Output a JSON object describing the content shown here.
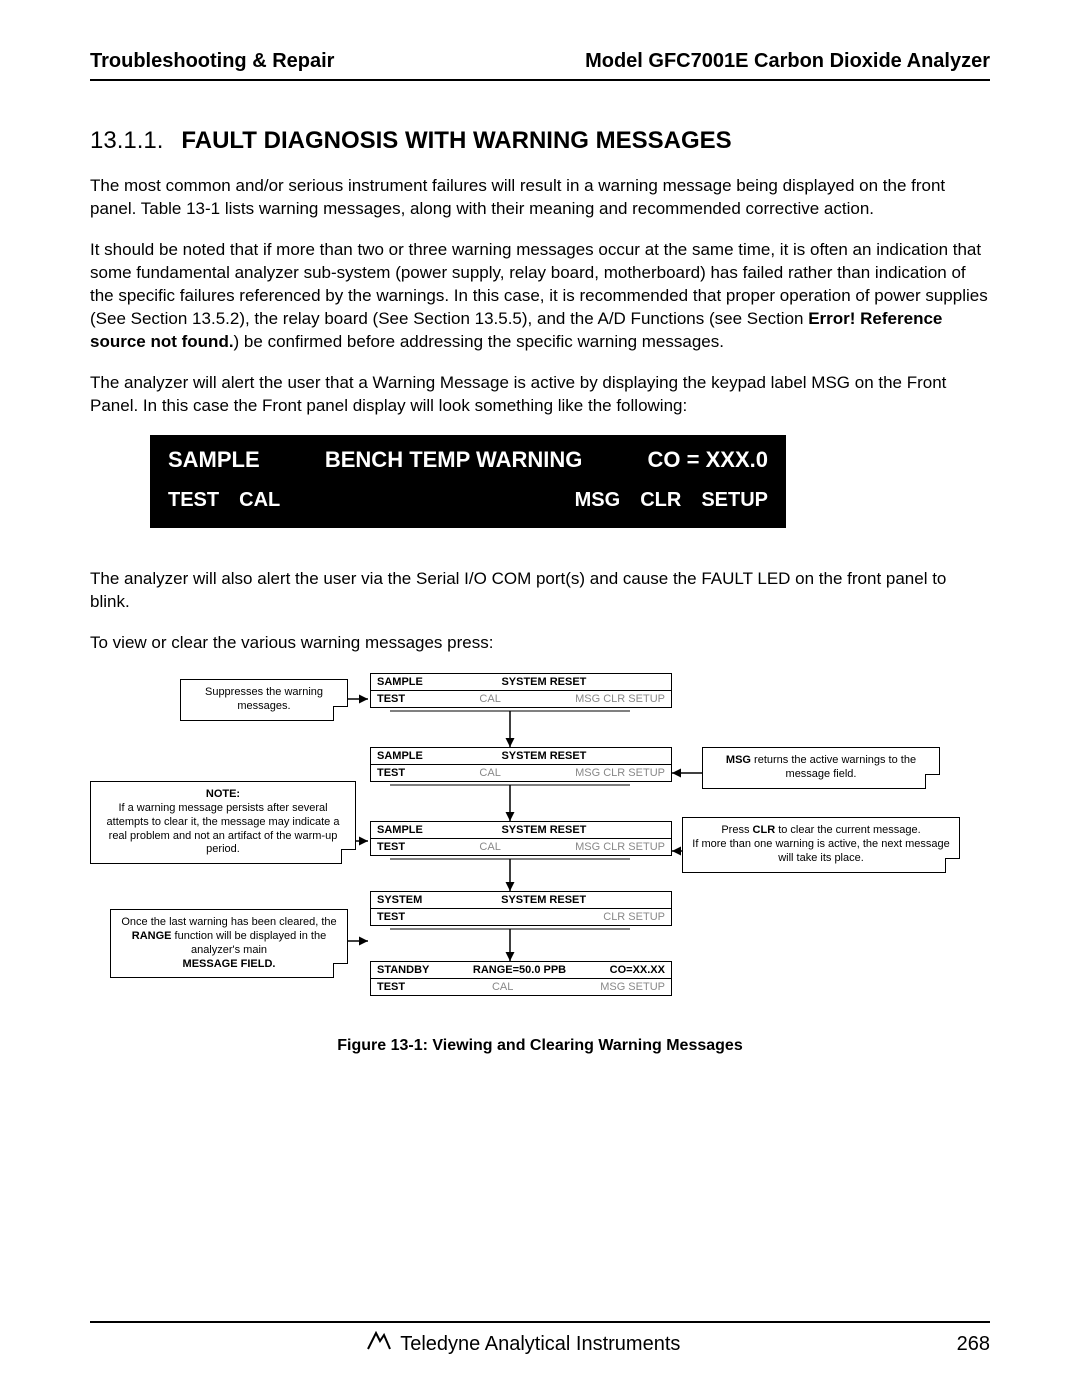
{
  "header": {
    "left": "Troubleshooting & Repair",
    "right": "Model GFC7001E Carbon Dioxide Analyzer"
  },
  "section": {
    "num": "13.1.1.",
    "title": "FAULT DIAGNOSIS WITH WARNING MESSAGES"
  },
  "para1": "The most common and/or serious instrument failures will result in a warning message being displayed on the front panel.  Table 13-1 lists warning messages, along with their meaning and recommended corrective action.",
  "para2a": "It should be noted that if more than two or three warning messages occur at the same time, it is often an indication that some fundamental analyzer sub-system (power supply, relay board, motherboard) has failed rather than indication of the specific failures referenced by the warnings.  In this case, it is recommended that proper operation of power supplies (See Section 13.5.2), the relay board (See Section 13.5.5), and the A/D Functions (see Section ",
  "para2b": "Error! Reference source not found.",
  "para2c": ") be confirmed before addressing the specific warning messages.",
  "para3": "The analyzer will alert the user that a Warning Message is active by displaying the keypad label MSG on the Front Panel.  In this case the Front panel display will look something like the following:",
  "lcd": {
    "r1a": "SAMPLE",
    "r1b": "BENCH TEMP WARNING",
    "r1c": "CO = XXX.0",
    "r2": [
      "TEST",
      "CAL",
      "MSG",
      "CLR",
      "SETUP"
    ]
  },
  "para4": "The analyzer will also alert the user via the Serial I/O COM port(s) and cause the FAULT LED on the front panel to blink.",
  "para5": "To view or clear the various warning messages press:",
  "panels": [
    {
      "tl": "SAMPLE",
      "tc": "SYSTEM RESET",
      "tr": "",
      "bl": "TEST",
      "bm": "CAL",
      "br": "MSG  CLR  SETUP"
    },
    {
      "tl": "SAMPLE",
      "tc": "SYSTEM RESET",
      "tr": "",
      "bl": "TEST",
      "bm": "CAL",
      "br": "MSG  CLR  SETUP"
    },
    {
      "tl": "SAMPLE",
      "tc": "SYSTEM RESET",
      "tr": "",
      "bl": "TEST",
      "bm": "CAL",
      "br": "MSG  CLR  SETUP"
    },
    {
      "tl": "SYSTEM",
      "tc": "SYSTEM RESET",
      "tr": "",
      "bl": "TEST",
      "bm": "",
      "br": "CLR  SETUP"
    },
    {
      "tl": "STANDBY",
      "tc": "RANGE=50.0 PPB",
      "tr": "CO=XX.XX",
      "bl": "TEST",
      "bm": "CAL",
      "br": "MSG           SETUP"
    }
  ],
  "notes": {
    "suppress": "Suppresses the warning messages.",
    "persistTitle": "NOTE:",
    "persist": "If a warning message persists after several attempts to clear it, the message may indicate a real problem and not an artifact of the warm-up period.",
    "range1": "Once the last warning has been cleared, the ",
    "rangeBold": "RANGE",
    "range2": " function will be displayed in the analyzer's main ",
    "rangeBold2": "MESSAGE FIELD.",
    "msg1": "MSG",
    "msg2": " returns the active warnings to the message field.",
    "clr1": "Press ",
    "clrBold": "CLR",
    "clr2": " to clear the current message.",
    "clr3": "If more than one warning is active, the next message will take its place."
  },
  "figcaption": "Figure 13-1:     Viewing and Clearing Warning Messages",
  "footer": {
    "brand": "Teledyne Analytical Instruments",
    "page": "268"
  }
}
